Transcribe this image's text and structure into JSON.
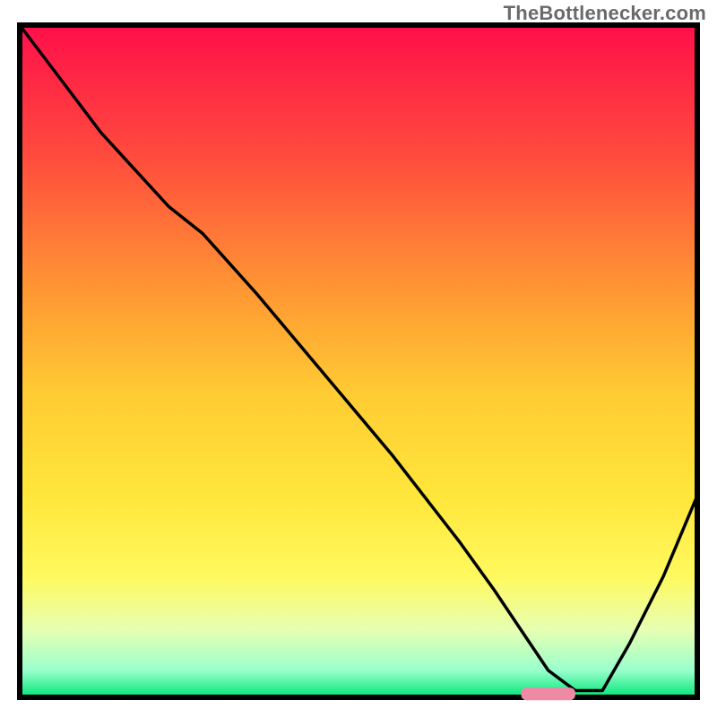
{
  "watermark": "TheBottlenecker.com",
  "chart_data": {
    "type": "line",
    "title": "",
    "xlabel": "",
    "ylabel": "",
    "xlim": [
      0,
      100
    ],
    "ylim": [
      0,
      100
    ],
    "grid": false,
    "legend": false,
    "background": {
      "type": "vertical_gradient",
      "stops": [
        {
          "pos": 0.0,
          "color": "#ff0f4a"
        },
        {
          "pos": 0.2,
          "color": "#ff4d3d"
        },
        {
          "pos": 0.4,
          "color": "#ff9933"
        },
        {
          "pos": 0.55,
          "color": "#ffcc33"
        },
        {
          "pos": 0.7,
          "color": "#ffe63b"
        },
        {
          "pos": 0.82,
          "color": "#fff95e"
        },
        {
          "pos": 0.9,
          "color": "#e6ffb3"
        },
        {
          "pos": 0.96,
          "color": "#99ffcc"
        },
        {
          "pos": 1.0,
          "color": "#00e676"
        }
      ]
    },
    "series": [
      {
        "name": "bottleneck-curve",
        "x": [
          0,
          6,
          12,
          22,
          27,
          35,
          45,
          55,
          65,
          70,
          74,
          78,
          82,
          86,
          90,
          95,
          100
        ],
        "y": [
          100,
          92,
          84,
          73,
          69,
          60,
          48,
          36,
          23,
          16,
          10,
          4,
          1,
          1,
          8,
          18,
          30
        ]
      }
    ],
    "marker": {
      "shape": "rounded-bar",
      "color": "#ef8aa6",
      "x_start": 74,
      "x_end": 82,
      "y": 0.5
    }
  }
}
